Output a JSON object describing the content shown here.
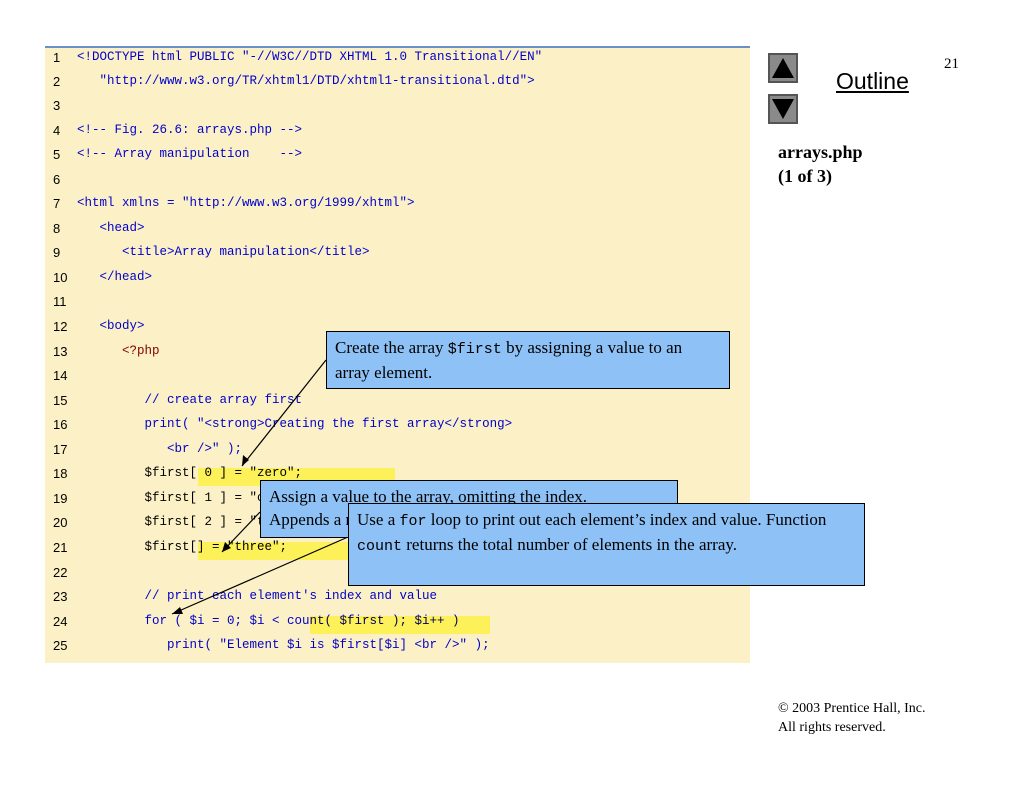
{
  "slide": {
    "page_number": "21",
    "nav": {
      "up_icon": "up-triangle-icon",
      "down_icon": "down-triangle-icon",
      "outline_label": "Outline"
    },
    "file_title_line1": "arrays.php",
    "file_title_line2": "(1 of 3)",
    "copyright_line1": "© 2003 Prentice Hall, Inc.",
    "copyright_line2": "All rights reserved."
  },
  "code": {
    "lines": [
      {
        "n": "1",
        "text": "<!DOCTYPE html PUBLIC \"-//W3C//DTD XHTML 1.0 Transitional//EN\""
      },
      {
        "n": "2",
        "text": "   \"http://www.w3.org/TR/xhtml1/DTD/xhtml1-transitional.dtd\">"
      },
      {
        "n": "3",
        "text": ""
      },
      {
        "n": "4",
        "text": "<!-- Fig. 26.6: arrays.php -->"
      },
      {
        "n": "5",
        "text": "<!-- Array manipulation    -->"
      },
      {
        "n": "6",
        "text": ""
      },
      {
        "n": "7",
        "text": "<html xmlns = \"http://www.w3.org/1999/xhtml\">"
      },
      {
        "n": "8",
        "text": "   <head>"
      },
      {
        "n": "9",
        "text": "      <title>Array manipulation</title>"
      },
      {
        "n": "10",
        "text": "   </head>"
      },
      {
        "n": "11",
        "text": ""
      },
      {
        "n": "12",
        "text": "   <body>"
      },
      {
        "n": "13",
        "text": "      <?php"
      },
      {
        "n": "14",
        "text": ""
      },
      {
        "n": "15",
        "text": "         // create array first"
      },
      {
        "n": "16",
        "text": "         print( \"<strong>Creating the first array</strong>"
      },
      {
        "n": "17",
        "text": "            <br />\" );"
      },
      {
        "n": "18",
        "text": "         $first[ 0 ] = \"zero\";"
      },
      {
        "n": "19",
        "text": "         $first[ 1 ] = \"one\";"
      },
      {
        "n": "20",
        "text": "         $first[ 2 ] = \"two\";"
      },
      {
        "n": "21",
        "text": "         $first[] = \"three\";"
      },
      {
        "n": "22",
        "text": ""
      },
      {
        "n": "23",
        "text": "         // print each element's index and value"
      },
      {
        "n": "24",
        "text": "         for ( $i = 0; $i < count( $first ); $i++ )"
      },
      {
        "n": "25",
        "text": "            print( \"Element $i is $first[$i] <br />\" );"
      }
    ]
  },
  "callouts": {
    "c1": {
      "a": "Create the array ",
      "code": "$first",
      "b": " by assigning a value to an array element."
    },
    "c2": {
      "line1": "Assign a value to the array, omitting the index.",
      "line2": "Appends a new element to the end of the array."
    },
    "c3": {
      "a": "Use a ",
      "code1": "for",
      "b": " loop to print out each element’s index and value. Function ",
      "code2": "count",
      "c": " returns the total number of elements in the array."
    }
  }
}
